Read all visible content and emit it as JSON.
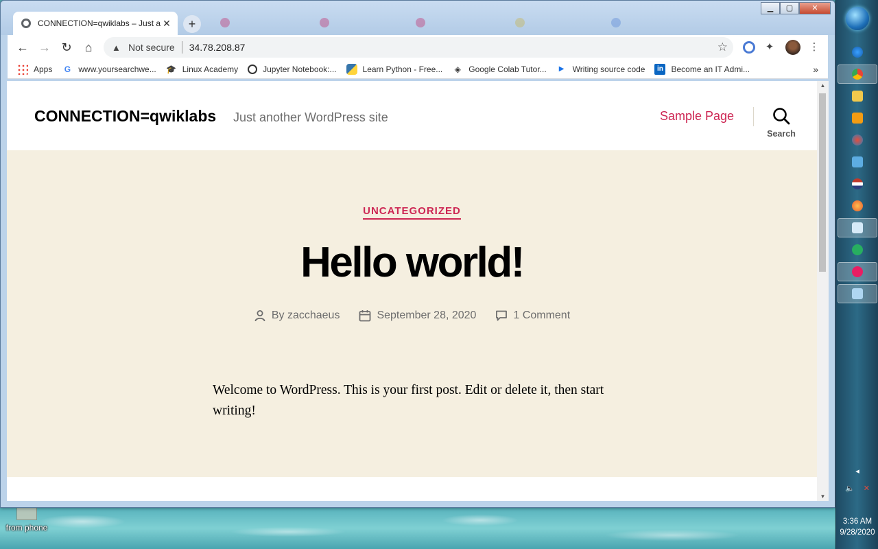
{
  "desktop": {
    "icon_label": "from phone"
  },
  "browser": {
    "active_tab": {
      "title": "CONNECTION=qwiklabs – Just a",
      "close_glyph": "✕"
    },
    "new_tab_glyph": "+",
    "window_controls": {
      "minimize": "▁",
      "maximize": "▢",
      "close": "✕"
    },
    "toolbar": {
      "back_glyph": "←",
      "forward_glyph": "→",
      "reload_glyph": "↻",
      "home_glyph": "⌂",
      "security_glyph": "▲",
      "security_label": "Not secure",
      "url": "34.78.208.87",
      "star_glyph": "☆",
      "extensions_glyph": "✦",
      "menu_glyph": "⋮"
    },
    "bookmarks": [
      {
        "label": "Apps",
        "icon": "apps-grid-icon",
        "color": "#e94235"
      },
      {
        "label": "www.yoursearchwe...",
        "icon": "google-icon",
        "color": "#4285f4"
      },
      {
        "label": "Linux Academy",
        "icon": "graduation-cap-icon",
        "color": "#333333"
      },
      {
        "label": "Jupyter Notebook:...",
        "icon": "jupyter-icon",
        "color": "#333333"
      },
      {
        "label": "Learn Python - Free...",
        "icon": "python-icon",
        "color": "#3776ab"
      },
      {
        "label": "Google Colab Tutor...",
        "icon": "diamond-icon",
        "color": "#333333"
      },
      {
        "label": "Writing source code",
        "icon": "play-icon",
        "color": "#1a73e8"
      },
      {
        "label": "Become an IT Admi...",
        "icon": "linkedin-icon",
        "color": "#0a66c2"
      }
    ],
    "bookmarks_more": "»"
  },
  "site": {
    "title": "CONNECTION=qwiklabs",
    "description": "Just another WordPress site",
    "menu_item": "Sample Page",
    "search_label": "Search",
    "accent_color": "#cd2653",
    "hero_bg": "#f5efe0"
  },
  "post": {
    "category": "UNCATEGORIZED",
    "title": "Hello world!",
    "author": "By zacchaeus",
    "date": "September 28, 2020",
    "comments": "1 Comment",
    "content": "Welcome to WordPress. This is your first post. Edit or delete it, then start writing!"
  },
  "taskbar": {
    "clock_time": "3:36 AM",
    "clock_date": "9/28/2020"
  }
}
